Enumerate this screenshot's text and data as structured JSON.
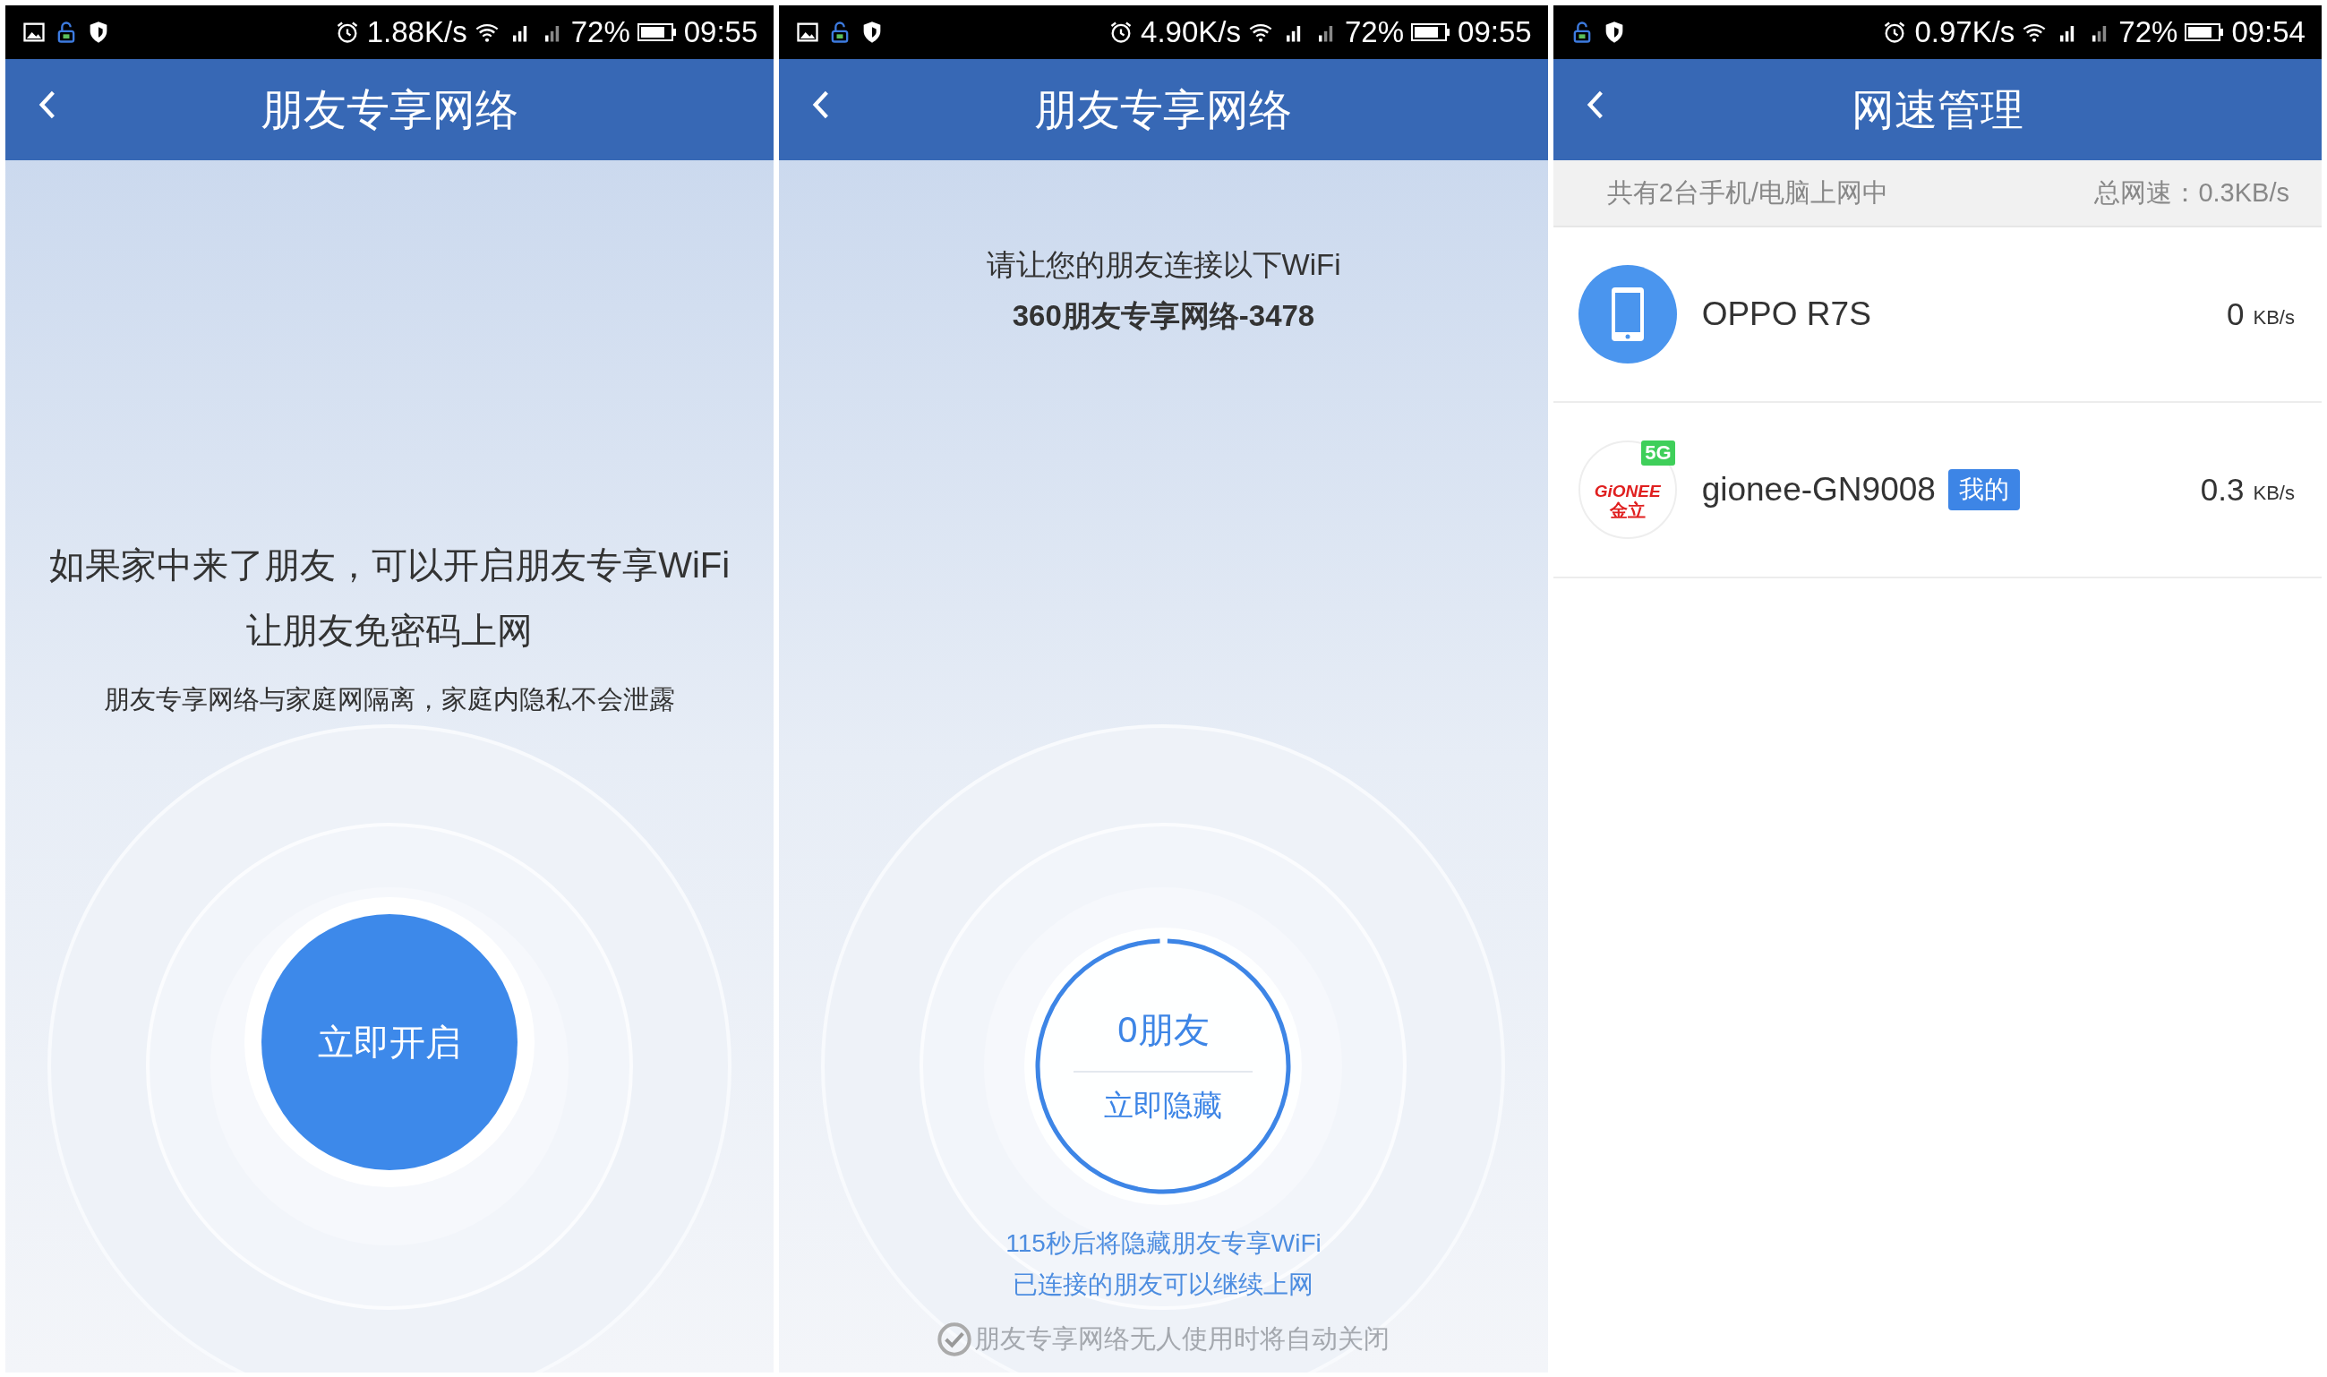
{
  "screens": [
    {
      "kind": "share_intro",
      "status_bar": {
        "notification_icons": [
          {
            "kind": "image"
          },
          {
            "kind": "lock"
          },
          {
            "kind": "shield"
          }
        ],
        "speed": "1.88K/s",
        "battery": "72%",
        "time": "09:55"
      },
      "title": "朋友专享网络",
      "headline_lines": [
        "如果家中来了朋友，可以开启朋友专享WiFi",
        "让朋友免密码上网"
      ],
      "note": "朋友专享网络与家庭网隔离，家庭内隐私不会泄露",
      "button": "立即开启"
    },
    {
      "kind": "share_active",
      "status_bar": {
        "notification_icons": [
          {
            "kind": "image"
          },
          {
            "kind": "lock"
          },
          {
            "kind": "shield"
          }
        ],
        "speed": "4.90K/s",
        "battery": "72%",
        "time": "09:55"
      },
      "title": "朋友专享网络",
      "instruction": "请让您的朋友连接以下WiFi",
      "wifi_name": "360朋友专享网络-3478",
      "friend_count": "0朋友",
      "hide_button": "立即隐藏",
      "countdown": {
        "level": 0.99
      },
      "info_lines": [
        "115秒后将隐藏朋友专享WiFi",
        "已连接的朋友可以继续上网"
      ],
      "auto_close": {
        "label": "朋友专享网络无人使用时将自动关闭",
        "checked": true
      }
    },
    {
      "kind": "speed_manager",
      "status_bar": {
        "notification_icons": [
          {
            "kind": "lock"
          },
          {
            "kind": "shield"
          }
        ],
        "speed": "0.97K/s",
        "battery": "72%",
        "time": "09:54"
      },
      "title": "网速管理",
      "summary": "共有2台手机/电脑上网中",
      "total_speed": "总网速：0.3KB/s",
      "devices": [
        {
          "name": "OPPO R7S",
          "icon": {
            "kind": "phone"
          },
          "speed": "0",
          "unit": "KB/s"
        },
        {
          "name": "gionee-GN9008",
          "icon": {
            "kind": "brand_logo",
            "text": "GiONEE",
            "text_cn": "金立",
            "badge": "5G"
          },
          "tag": "我的",
          "speed": "0.3",
          "unit": "KB/s"
        }
      ]
    }
  ]
}
